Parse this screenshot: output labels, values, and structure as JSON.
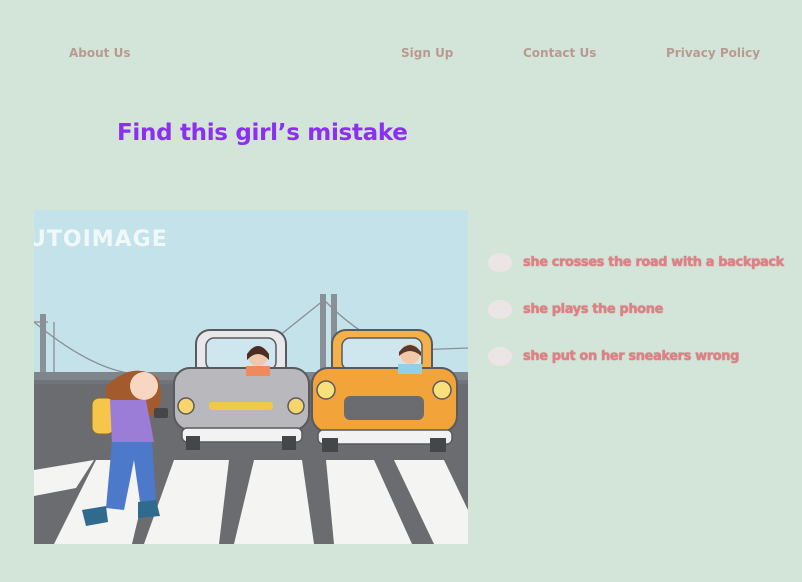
{
  "nav": {
    "about": "About Us",
    "signup": "Sign Up",
    "contact": "Contact Us",
    "privacy": "Privacy Policy"
  },
  "quiz": {
    "title": "Find this girl’s mistake",
    "options": [
      "she crosses the road with a backpack",
      "she plays the phone",
      "she put on her sneakers wrong"
    ]
  },
  "image": {
    "watermark": "UTOIMAGE"
  },
  "colors": {
    "background": "#d3e5d8",
    "title": "#8b2ff0",
    "nav_text": "#b99a92",
    "option_text": "#e37f84",
    "radio_fill": "#ece5e6"
  }
}
